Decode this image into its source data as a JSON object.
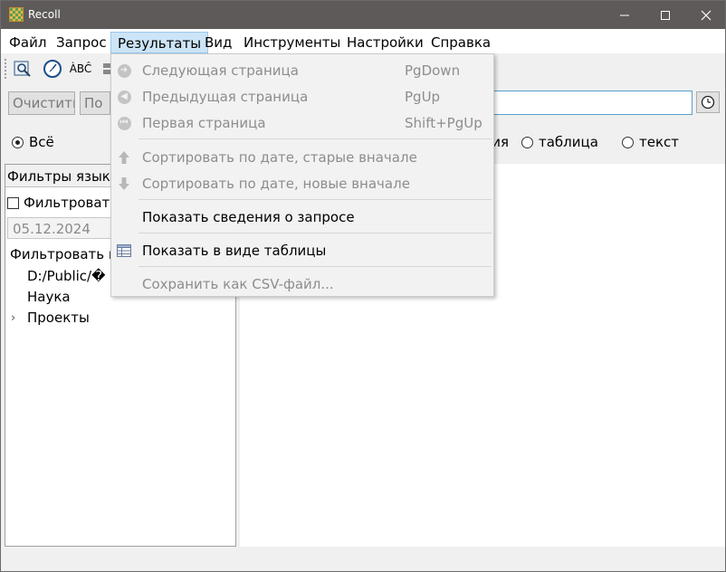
{
  "window": {
    "title": "Recoll",
    "min_icon": "minimize-icon",
    "max_icon": "maximize-icon",
    "close_icon": "close-icon"
  },
  "menubar": {
    "items": [
      "Файл",
      "Запрос",
      "Результаты",
      "Вид",
      "Инструменты",
      "Настройки",
      "Справка"
    ]
  },
  "toolbar": {
    "spell_label": "ÀBĈ"
  },
  "buttons": {
    "clear": "Очистить",
    "search": "По"
  },
  "radios": {
    "all": "Всё",
    "tail": "ция",
    "table": "таблица",
    "text": "текст"
  },
  "left": {
    "header": "Фильтры языка",
    "filter_check": "Фильтровать",
    "date": "05.12.2024",
    "tree_title": "Фильтровать ка",
    "tree_items": [
      "D:/Public/�",
      "Наука",
      "Проекты"
    ]
  },
  "results_menu": {
    "next_page": "Следующая страница",
    "next_page_sc": "PgDown",
    "prev_page": "Предыдущая страница",
    "prev_page_sc": "PgUp",
    "first_page": "Первая страница",
    "first_page_sc": "Shift+PgUp",
    "sort_old": "Сортировать по дате, старые вначале",
    "sort_new": "Сортировать по дате, новые вначале",
    "query_details": "Показать сведения о запросе",
    "as_table": "Показать в виде таблицы",
    "save_csv": "Сохранить как CSV-файл..."
  }
}
